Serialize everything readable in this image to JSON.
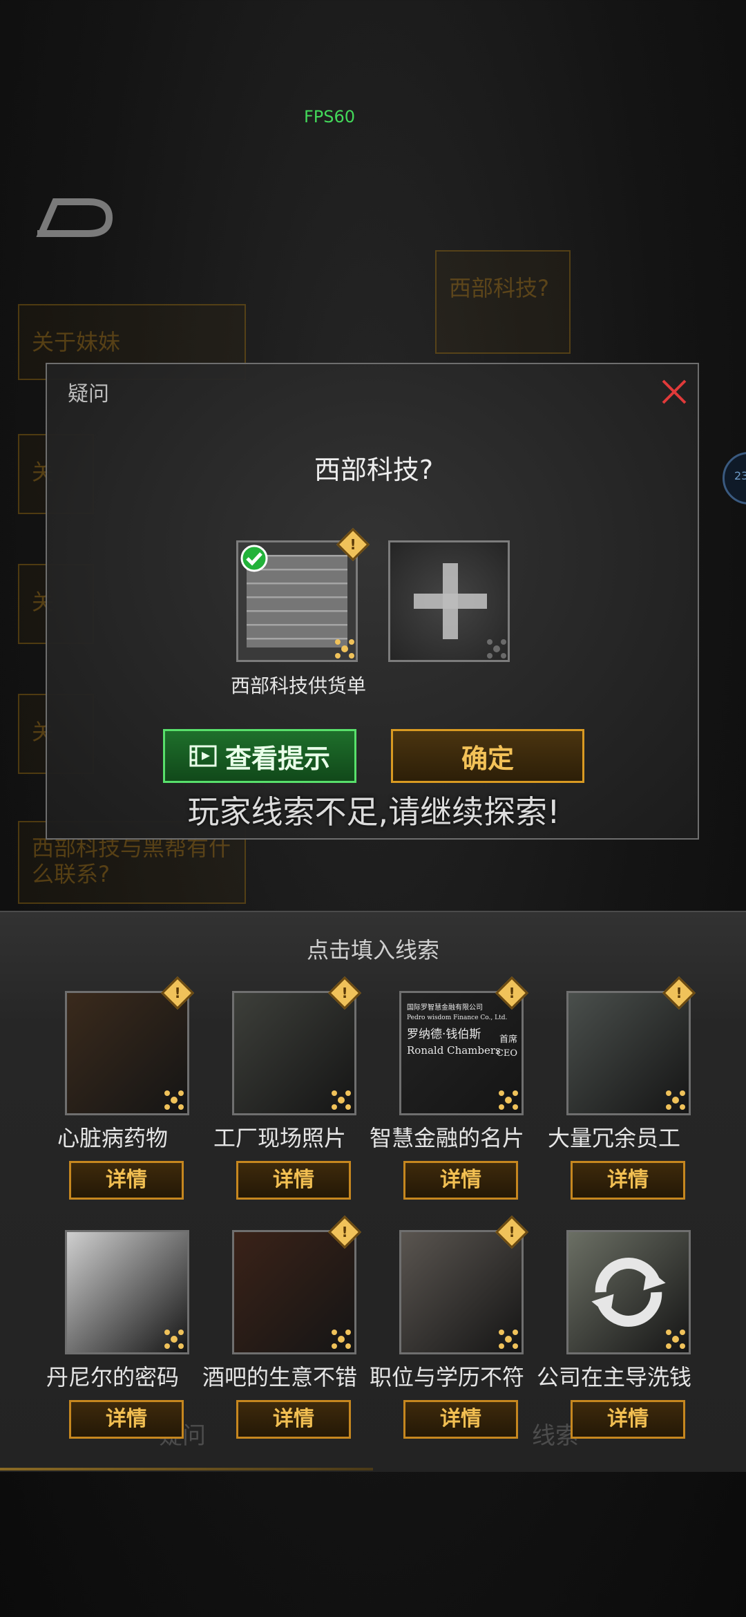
{
  "fps": "FPS60",
  "background": {
    "cards": [
      "关于妹妹",
      "西部科技?",
      "关",
      "关",
      "关",
      "西部科技与黑帮有什么联系?"
    ]
  },
  "dialog": {
    "title": "疑问",
    "question": "西部科技?",
    "slots": [
      {
        "label": "西部科技供货单",
        "filled": true
      },
      {
        "label": "",
        "filled": false
      }
    ],
    "hint_button": "查看提示",
    "ok_button": "确定",
    "toast": "玩家线索不足,请继续探索!"
  },
  "panel": {
    "title": "点击填入线索",
    "behind_tabs": [
      "疑问",
      "线索"
    ],
    "detail_label": "详情",
    "clues": [
      {
        "name": "心脏病药物",
        "alert": true,
        "bg": "#3a2a1c"
      },
      {
        "name": "工厂现场照片",
        "alert": true,
        "bg": "#3d3f3a"
      },
      {
        "name": "智慧金融的名片",
        "alert": true,
        "bg": "#232323"
      },
      {
        "name": "大量冗余员工",
        "alert": true,
        "bg": "#4a4f4c"
      },
      {
        "name": "丹尼尔的密码",
        "alert": false,
        "bg": "#cfcfcf"
      },
      {
        "name": "酒吧的生意不错",
        "alert": true,
        "bg": "#3a2218"
      },
      {
        "name": "职位与学历不符",
        "alert": true,
        "bg": "#5a5550"
      },
      {
        "name": "公司在主导洗钱",
        "alert": false,
        "bg": "#6b6f64"
      }
    ],
    "card_text": {
      "company": "国际罗智慧金融有限公司",
      "company_en": "Pedro wisdom Finance Co., Ltd.",
      "person_cn": "罗纳德·钱伯斯",
      "person_en": "Ronald Chambers",
      "title_cn": "首席",
      "title_en": "CEO"
    }
  },
  "colors": {
    "accent_gold": "#d99a22",
    "accent_green": "#58e06b",
    "fps_green": "#43d95a",
    "close_red": "#e03a3a"
  }
}
